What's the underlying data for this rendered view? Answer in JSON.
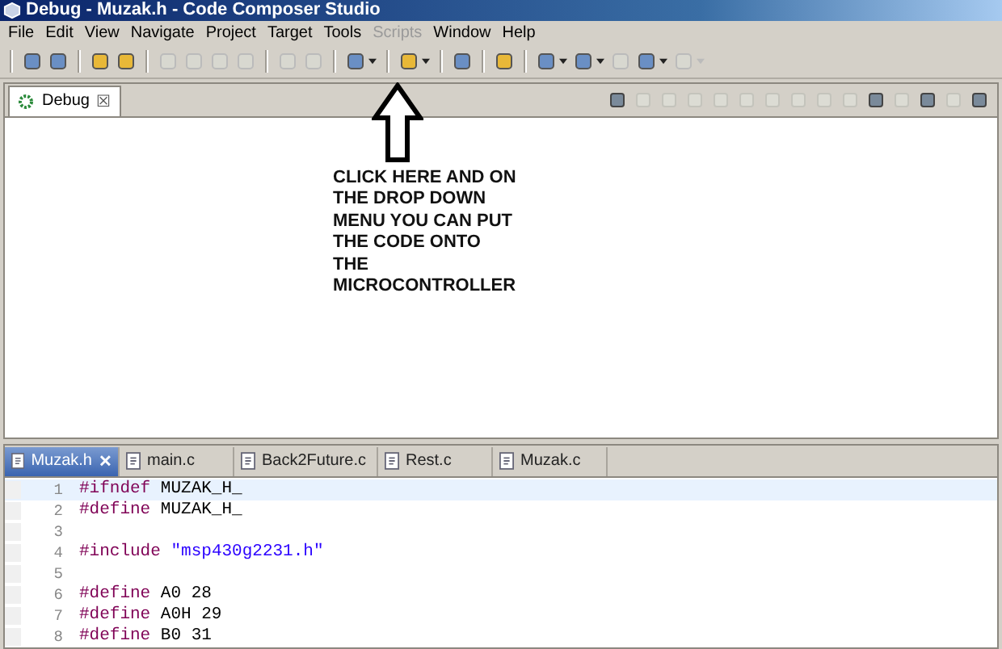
{
  "window": {
    "title": "Debug - Muzak.h - Code Composer Studio"
  },
  "menu": [
    {
      "label": "File",
      "disabled": false
    },
    {
      "label": "Edit",
      "disabled": false
    },
    {
      "label": "View",
      "disabled": false
    },
    {
      "label": "Navigate",
      "disabled": false
    },
    {
      "label": "Project",
      "disabled": false
    },
    {
      "label": "Target",
      "disabled": false
    },
    {
      "label": "Tools",
      "disabled": false
    },
    {
      "label": "Scripts",
      "disabled": true
    },
    {
      "label": "Window",
      "disabled": false
    },
    {
      "label": "Help",
      "disabled": false
    }
  ],
  "toolbar": [
    [
      {
        "disabled": false,
        "dropdown": false
      },
      {
        "disabled": false,
        "dropdown": false
      }
    ],
    [
      {
        "disabled": false,
        "dropdown": false
      },
      {
        "disabled": false,
        "dropdown": false
      }
    ],
    [
      {
        "disabled": true,
        "dropdown": false
      },
      {
        "disabled": true,
        "dropdown": false
      },
      {
        "disabled": true,
        "dropdown": false
      },
      {
        "disabled": true,
        "dropdown": false
      }
    ],
    [
      {
        "disabled": true,
        "dropdown": false
      },
      {
        "disabled": true,
        "dropdown": false
      }
    ],
    [
      {
        "disabled": false,
        "dropdown": true
      }
    ],
    [
      {
        "disabled": false,
        "dropdown": true
      }
    ],
    [
      {
        "disabled": false,
        "dropdown": false
      }
    ],
    [
      {
        "disabled": false,
        "dropdown": false
      }
    ],
    [
      {
        "disabled": false,
        "dropdown": true
      },
      {
        "disabled": false,
        "dropdown": true
      },
      {
        "disabled": true,
        "dropdown": false
      },
      {
        "disabled": false,
        "dropdown": true
      },
      {
        "disabled": true,
        "dropdown": true
      }
    ]
  ],
  "debug_view": {
    "tab": {
      "label": "Debug",
      "close": "☒"
    },
    "tools": [
      {
        "disabled": false
      },
      {
        "disabled": true
      },
      {
        "disabled": true
      },
      {
        "disabled": true
      },
      {
        "disabled": true
      },
      {
        "disabled": true
      },
      {
        "disabled": true
      },
      {
        "disabled": true
      },
      {
        "disabled": true
      },
      {
        "disabled": true
      },
      {
        "disabled": false
      },
      {
        "disabled": true
      },
      {
        "disabled": false
      },
      {
        "disabled": true
      },
      {
        "disabled": false
      }
    ],
    "annotation": [
      "CLICK HERE AND ON",
      "THE DROP DOWN",
      "MENU YOU CAN PUT",
      "THE CODE ONTO",
      "THE",
      "MICROCONTROLLER"
    ]
  },
  "editor": {
    "tabs": [
      {
        "label": "Muzak.h",
        "selected": true,
        "close": "✕"
      },
      {
        "label": "main.c",
        "selected": false
      },
      {
        "label": "Back2Future.c",
        "selected": false
      },
      {
        "label": "Rest.c",
        "selected": false
      },
      {
        "label": "Muzak.c",
        "selected": false
      }
    ],
    "lines": [
      {
        "number": "1",
        "keyword": "#ifndef",
        "text": "MUZAK_H_",
        "current": true
      },
      {
        "number": "2",
        "keyword": "#define",
        "text": "MUZAK_H_",
        "current": false
      },
      {
        "number": "3",
        "current": false
      },
      {
        "number": "4",
        "keyword": "#include",
        "string": "\"msp430g2231.h\"",
        "current": false
      },
      {
        "number": "5",
        "current": false
      },
      {
        "number": "6",
        "keyword": "#define",
        "text": "A0 28",
        "current": false
      },
      {
        "number": "7",
        "keyword": "#define",
        "text": "A0H 29",
        "current": false
      },
      {
        "number": "8",
        "keyword": "#define",
        "text": "B0 31",
        "current": false
      }
    ]
  }
}
